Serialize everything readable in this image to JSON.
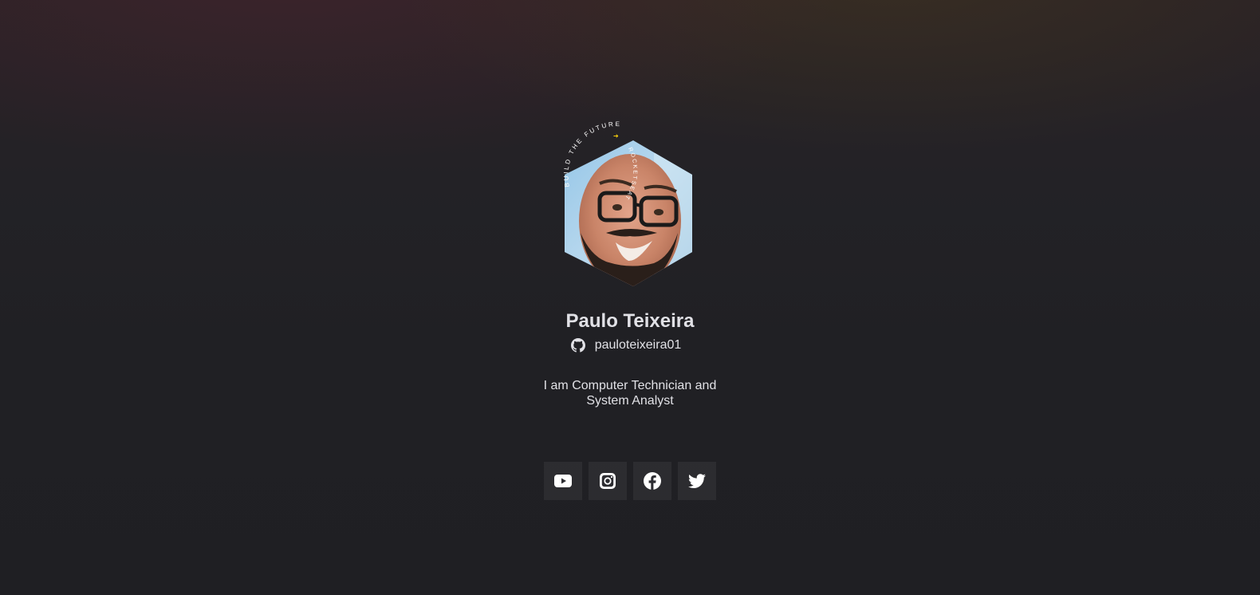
{
  "profile": {
    "name": "Paulo Teixeira",
    "github_username": "pauloteixeira01",
    "bio_line1": "I am Computer Technician and",
    "bio_line2": "System Analyst",
    "avatar_ring_text": "BUILD THE FUTURE → ROCKETSEAT",
    "avatar_alt": "Paulo Teixeira"
  },
  "socials": [
    {
      "name": "YouTube",
      "icon": "youtube-icon"
    },
    {
      "name": "Instagram",
      "icon": "instagram-icon"
    },
    {
      "name": "Facebook",
      "icon": "facebook-icon"
    },
    {
      "name": "Twitter",
      "icon": "twitter-icon"
    }
  ],
  "colors": {
    "background": "#202024",
    "text": "#e1e1e6",
    "ring_accent": "#ffd60a",
    "button_bg": "rgba(255,255,255,0.06)"
  }
}
